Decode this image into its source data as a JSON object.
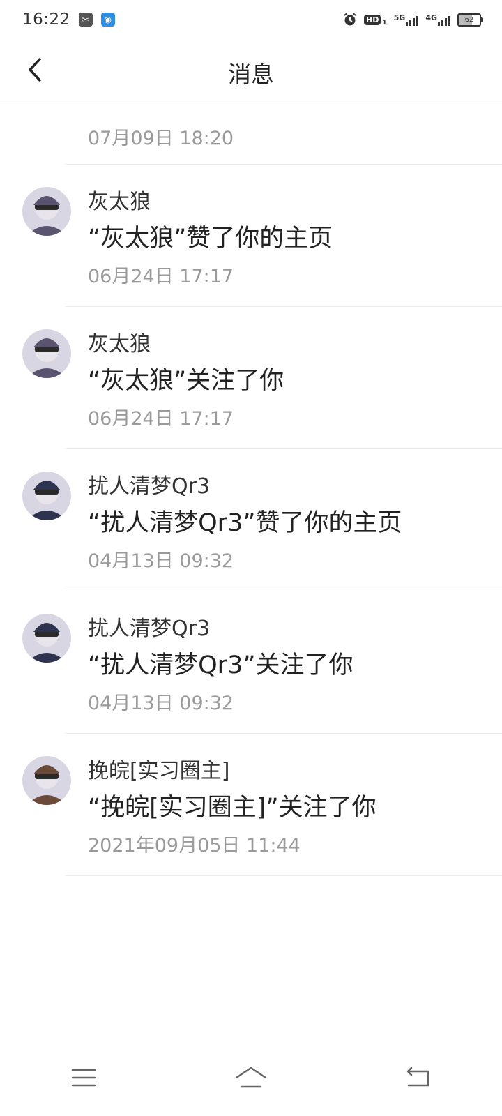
{
  "status_bar": {
    "time": "16:22",
    "network_1": "5G",
    "network_2": "4G",
    "hd_label": "HD",
    "sim_index": "1",
    "battery_level": "62"
  },
  "header": {
    "title": "消息"
  },
  "first_timestamp": "07月09日  18:20",
  "notifications": [
    {
      "username": "灰太狼",
      "message": "“灰太狼”赞了你的主页",
      "time": "06月24日  17:17",
      "avatar_color": "#5a5470"
    },
    {
      "username": "灰太狼",
      "message": "“灰太狼”关注了你",
      "time": "06月24日  17:17",
      "avatar_color": "#5a5470"
    },
    {
      "username": "扰人清梦Qr3",
      "message": "“扰人清梦Qr3”赞了你的主页",
      "time": "04月13日  09:32",
      "avatar_color": "#2e3350"
    },
    {
      "username": "扰人清梦Qr3",
      "message": "“扰人清梦Qr3”关注了你",
      "time": "04月13日  09:32",
      "avatar_color": "#2e3350"
    },
    {
      "username": "挽皖[实习圈主]",
      "message": "“挽皖[实习圈主]”关注了你",
      "time": "2021年09月05日  11:44",
      "avatar_color": "#6b4a3a"
    }
  ],
  "icons": {
    "back": "chevron-left-icon",
    "menu": "menu-icon",
    "home": "home-icon",
    "return": "return-icon"
  }
}
